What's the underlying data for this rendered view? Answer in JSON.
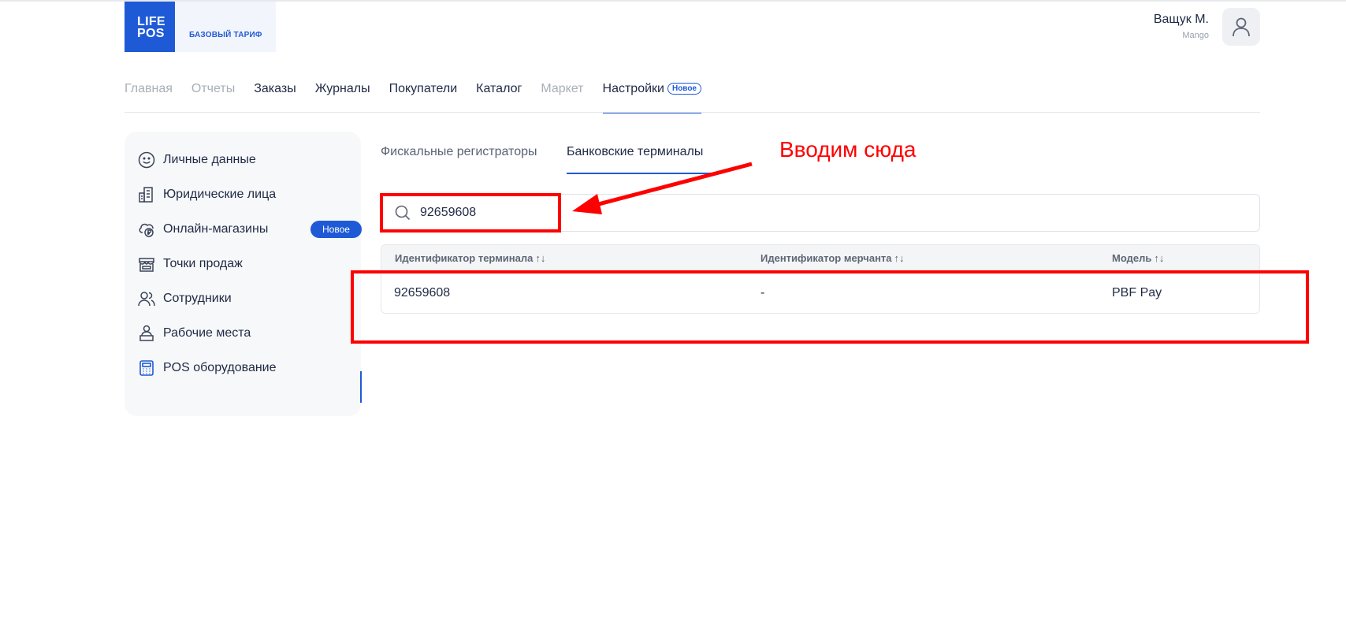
{
  "brand": {
    "logo_line1": "LIFE",
    "logo_line2": "POS",
    "tariff": "БАЗОВЫЙ ТАРИФ"
  },
  "user": {
    "name": "Ващук М.",
    "org": "Mango"
  },
  "nav": {
    "items": [
      {
        "label": "Главная",
        "state": "muted"
      },
      {
        "label": "Отчеты",
        "state": "muted"
      },
      {
        "label": "Заказы",
        "state": "normal"
      },
      {
        "label": "Журналы",
        "state": "normal"
      },
      {
        "label": "Покупатели",
        "state": "normal"
      },
      {
        "label": "Каталог",
        "state": "normal"
      },
      {
        "label": "Маркет",
        "state": "muted"
      },
      {
        "label": "Настройки",
        "state": "active",
        "badge": "Новое"
      }
    ]
  },
  "sidebar": {
    "items": [
      {
        "label": "Личные данные",
        "icon": "smile-icon"
      },
      {
        "label": "Юридические лица",
        "icon": "building-icon"
      },
      {
        "label": "Онлайн-магазины",
        "icon": "ruble-cloud-icon",
        "badge": "Новое"
      },
      {
        "label": "Точки продаж",
        "icon": "store-icon"
      },
      {
        "label": "Сотрудники",
        "icon": "users-icon"
      },
      {
        "label": "Рабочие места",
        "icon": "workplace-icon"
      },
      {
        "label": "POS оборудование",
        "icon": "calculator-icon",
        "active": true
      }
    ]
  },
  "subtabs": [
    {
      "label": "Фискальные регистраторы",
      "active": false
    },
    {
      "label": "Банковские терминалы",
      "active": true
    }
  ],
  "search": {
    "value": "92659608"
  },
  "table": {
    "headers": [
      {
        "label": "Идентификатор терминала",
        "sort": "↑↓"
      },
      {
        "label": "Идентификатор мерчанта",
        "sort": "↑↓"
      },
      {
        "label": "Модель",
        "sort": "↑↓"
      }
    ],
    "rows": [
      {
        "terminal_id": "92659608",
        "merchant_id": "-",
        "model": "PBF Pay"
      }
    ]
  },
  "annotation": {
    "text": "Вводим сюда",
    "color": "#ff0000"
  },
  "colors": {
    "accent": "#1f5ad6",
    "text": "#1f2a44",
    "muted": "#a9aeb8",
    "annotation": "#ff0000"
  }
}
